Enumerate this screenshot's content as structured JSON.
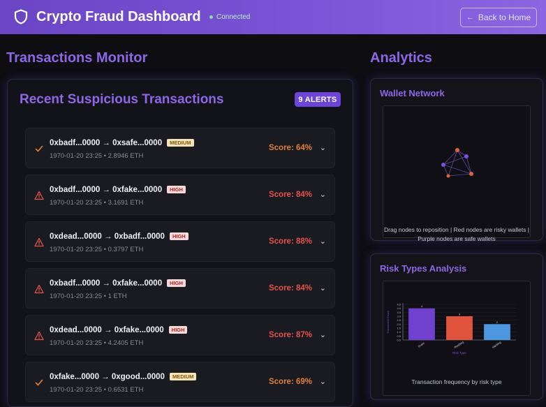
{
  "header": {
    "title": "Crypto Fraud Dashboard",
    "status": "Connected",
    "back_label": "Back to Home",
    "logo_icon": "shield-icon"
  },
  "transactions": {
    "section_title": "Transactions Monitor",
    "panel_title": "Recent Suspicious Transactions",
    "alerts_badge": "9 ALERTS",
    "items": [
      {
        "addr": "0xbadf...0000 → 0xsafe...0000",
        "severity": "MEDIUM",
        "meta": "1970-01-20 23:25 • 2.8946 ETH",
        "score": "Score: 64%",
        "icon": "check-icon"
      },
      {
        "addr": "0xbadf...0000 → 0xfake...0000",
        "severity": "HIGH",
        "meta": "1970-01-20 23:25 • 3.1691 ETH",
        "score": "Score: 84%",
        "icon": "warning-icon"
      },
      {
        "addr": "0xdead...0000 → 0xbadf...0000",
        "severity": "HIGH",
        "meta": "1970-01-20 23:25 • 0.3797 ETH",
        "score": "Score: 88%",
        "icon": "warning-icon"
      },
      {
        "addr": "0xbadf...0000 → 0xfake...0000",
        "severity": "HIGH",
        "meta": "1970-01-20 23:25 • 1 ETH",
        "score": "Score: 84%",
        "icon": "warning-icon"
      },
      {
        "addr": "0xdead...0000 → 0xfake...0000",
        "severity": "HIGH",
        "meta": "1970-01-20 23:25 • 4.2405 ETH",
        "score": "Score: 87%",
        "icon": "warning-icon"
      },
      {
        "addr": "0xfake...0000 → 0xgood...0000",
        "severity": "MEDIUM",
        "meta": "1970-01-20 23:25 • 0.6531 ETH",
        "score": "Score: 69%",
        "icon": "check-icon"
      }
    ]
  },
  "analytics": {
    "section_title": "Analytics",
    "network": {
      "title": "Wallet Network",
      "caption": "Drag nodes to reposition | Red nodes are risky wallets | Purple nodes are safe wallets"
    },
    "risk": {
      "title": "Risk Types Analysis",
      "caption": "Transaction frequency by risk type"
    }
  },
  "colors": {
    "accent": "#8d67e6",
    "medium_score": "#e0813a",
    "high_score": "#e4534a",
    "risky_node": "#e0623e",
    "safe_node": "#7a4fe0"
  },
  "chart_data": {
    "type": "bar",
    "categories": [
      "Scam",
      "Phishing",
      "Hacking"
    ],
    "values": [
      4,
      3,
      2
    ],
    "xlabel": "Risk Type",
    "ylabel": "Transaction Count",
    "ylim": [
      0,
      4.5
    ],
    "yticks": [
      "0.0",
      "0.5",
      "1.0",
      "1.5",
      "2.0",
      "2.5",
      "3.0",
      "3.5",
      "4.0",
      "4.5"
    ],
    "bar_colors": [
      "#7040cf",
      "#e0543e",
      "#4d97de"
    ]
  }
}
